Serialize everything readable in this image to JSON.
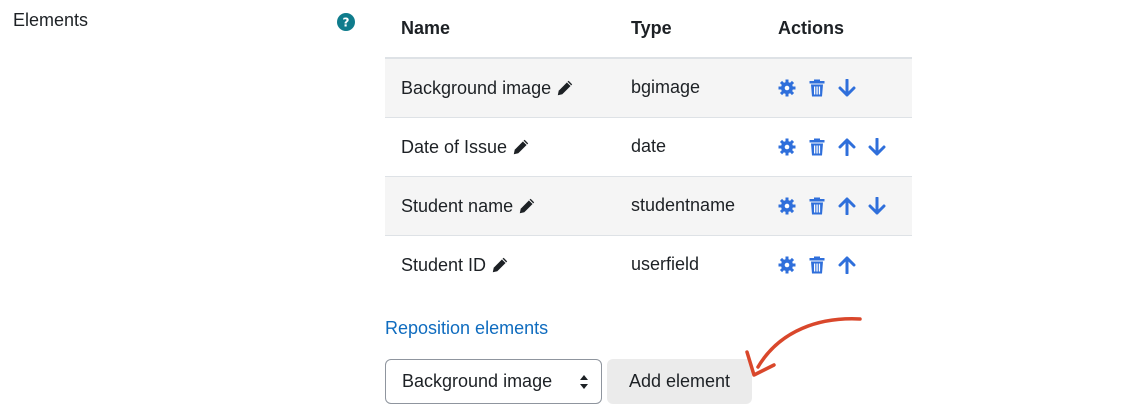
{
  "form": {
    "label": "Elements",
    "help_icon": "question-circle-icon"
  },
  "table": {
    "headers": {
      "name": "Name",
      "type": "Type",
      "actions": "Actions"
    },
    "rows": [
      {
        "name": "Background image",
        "type": "bgimage",
        "actions": [
          "settings",
          "delete",
          "move-down"
        ]
      },
      {
        "name": "Date of Issue",
        "type": "date",
        "actions": [
          "settings",
          "delete",
          "move-up",
          "move-down"
        ]
      },
      {
        "name": "Student name",
        "type": "studentname",
        "actions": [
          "settings",
          "delete",
          "move-up",
          "move-down"
        ]
      },
      {
        "name": "Student ID",
        "type": "userfield",
        "actions": [
          "settings",
          "delete",
          "move-up"
        ]
      }
    ]
  },
  "reposition_link": "Reposition elements",
  "add": {
    "selected": "Background image",
    "button_label": "Add element"
  },
  "colors": {
    "accent": "#0f6cbf",
    "icon_blue": "#2f6fdb",
    "help_teal": "#0f7c8c",
    "annotation_red": "#d9472b"
  }
}
